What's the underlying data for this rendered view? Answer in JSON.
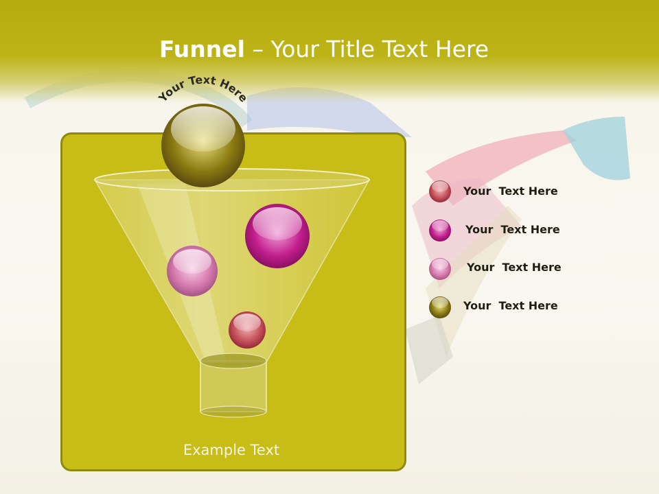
{
  "slide": {
    "title_bold": "Funnel",
    "title_rest": " – Your Title Text Here",
    "arc_label": "Your Text Here",
    "footer_text": "Example Text",
    "legend": [
      {
        "label": "Your  Text Here",
        "color": "#c85060"
      },
      {
        "label": "Your  Text Here",
        "color": "#c2208e"
      },
      {
        "label": "Your  Text Here",
        "color": "#d878b0"
      },
      {
        "label": "Your  Text Here",
        "color": "#6e5a1a"
      }
    ]
  },
  "colors": {
    "header": "#b5ac0e",
    "panel": "#c8bc17",
    "panel_border": "#8f8910",
    "background": "#f8f6ec"
  }
}
